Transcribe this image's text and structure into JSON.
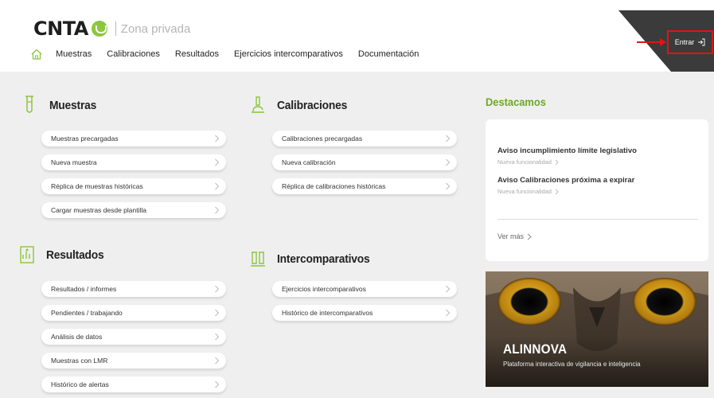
{
  "header": {
    "logo_text": "CNTA",
    "zone_label": "Zona privada",
    "nav": [
      "Muestras",
      "Calibraciones",
      "Resultados",
      "Ejercicios intercomparativos",
      "Documentación"
    ],
    "login_label": "Entrar"
  },
  "sections": {
    "muestras": {
      "title": "Muestras",
      "items": [
        "Muestras precargadas",
        "Nueva muestra",
        "Réplica de muestras históricas",
        "Cargar muestras desde plantilla"
      ]
    },
    "calibraciones": {
      "title": "Calibraciones",
      "items": [
        "Calibraciones precargadas",
        "Nueva calibración",
        "Réplica de calibraciones históricas"
      ]
    },
    "resultados": {
      "title": "Resultados",
      "items": [
        "Resultados / informes",
        "Pendientes / trabajando",
        "Análisis de datos",
        "Muestras con LMR",
        "Histórico de alertas"
      ]
    },
    "intercomparativos": {
      "title": "Intercomparativos",
      "items": [
        "Ejercicios intercomparativos",
        "Histórico de intercomparativos"
      ]
    }
  },
  "destacamos": {
    "title": "Destacamos",
    "items": [
      {
        "title": "Aviso incumplimiento límite legislativo",
        "sub": "Nueva funcionalidad"
      },
      {
        "title": "Aviso Calibraciones próxima a expirar",
        "sub": "Nueva funcionalidad"
      }
    ],
    "more_label": "Ver más"
  },
  "banner": {
    "title": "ALINNOVA",
    "subtitle": "Plataforma interactiva de vigilancia e inteligencia"
  },
  "colors": {
    "accent_green": "#8cc63f",
    "highlight_red": "#e01414",
    "dark_header": "#3b3b3b"
  },
  "icons": [
    "home-icon",
    "test-tube-icon",
    "microscope-icon",
    "clipboard-chart-icon",
    "lab-flasks-icon",
    "chevron-right-icon",
    "login-icon"
  ]
}
